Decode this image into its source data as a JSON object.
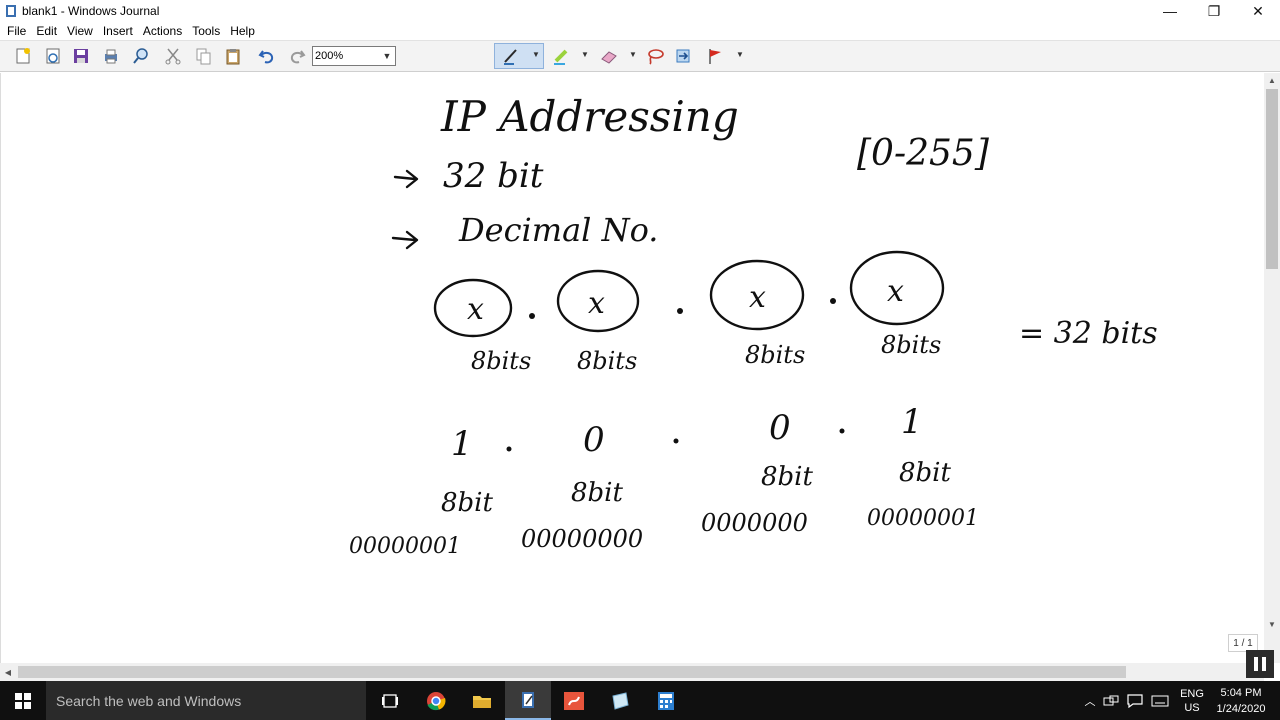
{
  "window": {
    "title": "blank1 - Windows Journal",
    "minimize": "—",
    "restore": "❐",
    "close": "✕"
  },
  "menu": [
    "File",
    "Edit",
    "View",
    "Insert",
    "Actions",
    "Tools",
    "Help"
  ],
  "toolbar": {
    "zoom_value": "200%",
    "icons": [
      "new-note-icon",
      "open-icon",
      "save-icon",
      "print-icon",
      "find-icon",
      "cut-icon",
      "copy-icon",
      "paste-icon",
      "undo-icon",
      "redo-icon",
      "pen-icon",
      "highlighter-icon",
      "eraser-icon",
      "lasso-icon",
      "insert-space-icon",
      "flag-icon"
    ]
  },
  "note": {
    "title": "IP Addressing",
    "point1": "32 bit",
    "point2": "Decimal No.",
    "range": "[0-255]",
    "octet_symbol": "x",
    "octet_label": "8bits",
    "total": "= 32 bits",
    "example_values": [
      "1",
      "0",
      "0",
      "1"
    ],
    "example_label": "8bit",
    "binary_values": [
      "00000001",
      "00000000",
      "0000000",
      "00000001"
    ]
  },
  "status": {
    "page_indicator": "1 / 1"
  },
  "taskbar": {
    "search_placeholder": "Search the web and Windows",
    "language_line1": "ENG",
    "language_line2": "US",
    "time": "5:04 PM",
    "date": "1/24/2020"
  }
}
